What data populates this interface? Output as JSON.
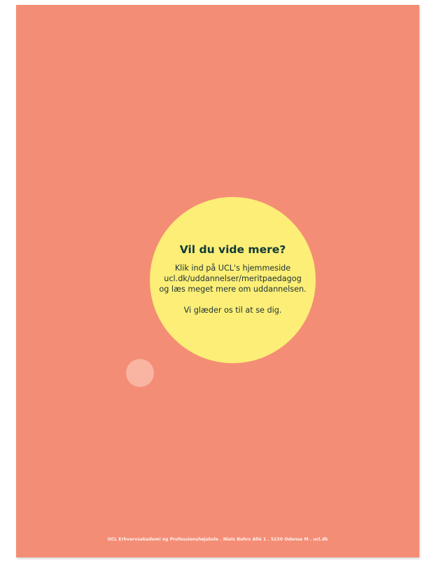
{
  "bubble": {
    "heading": "Vil du vide mere?",
    "line1": "Klik ind på UCL's hjemmeside",
    "line2": "ucl.dk/uddannelser/meritpaedagog",
    "line3": "og læs meget mere om uddannelsen.",
    "line4": "Vi glæder os til at se dig."
  },
  "footer": {
    "text": "UCL Erhvervsakademi og Professionshøjskole . Niels Bohrs Allé 1 . 5230 Odense M . ucl.dk"
  },
  "colors": {
    "page_background": "#f48d76",
    "bubble": "#fcee76",
    "small_bubble": "#f9b9a6",
    "heading_text": "#0f3a3a",
    "footer_text": "#fdf1ec"
  }
}
